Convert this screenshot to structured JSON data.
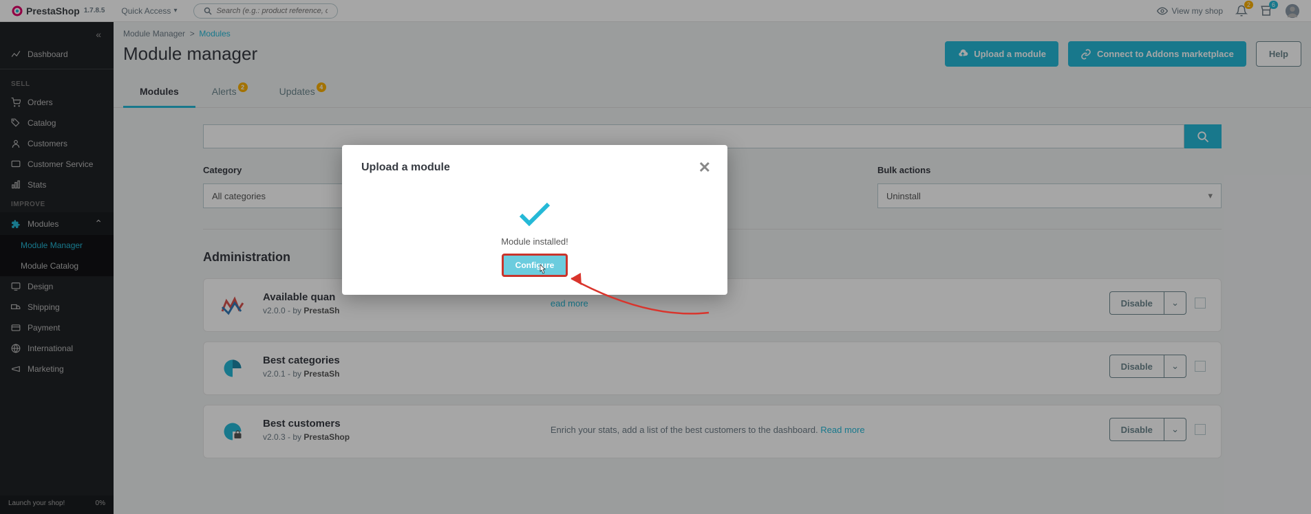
{
  "app": {
    "name": "PrestaShop",
    "version": "1.7.8.5"
  },
  "header": {
    "quick_access": "Quick Access",
    "search_placeholder": "Search (e.g.: product reference, custom",
    "view_shop": "View my shop",
    "notif_bell_count": "2",
    "notif_cart_count": "6"
  },
  "sidebar": {
    "dashboard": "Dashboard",
    "sections": {
      "sell": {
        "title": "SELL",
        "items": [
          "Orders",
          "Catalog",
          "Customers",
          "Customer Service",
          "Stats"
        ]
      },
      "improve": {
        "title": "IMPROVE",
        "items": [
          "Modules",
          "Design",
          "Shipping",
          "Payment",
          "International",
          "Marketing"
        ],
        "sub": [
          "Module Manager",
          "Module Catalog"
        ]
      }
    },
    "footer_left": "Launch your shop!",
    "footer_right": "0%"
  },
  "breadcrumb": {
    "parent": "Module Manager",
    "current": "Modules"
  },
  "page": {
    "title": "Module manager",
    "upload_btn": "Upload a module",
    "connect_btn": "Connect to Addons marketplace",
    "help_btn": "Help"
  },
  "tabs": {
    "modules": "Modules",
    "alerts": "Alerts",
    "alerts_count": "2",
    "updates": "Updates",
    "updates_count": "4"
  },
  "filters": {
    "category_label": "Category",
    "category_value": "All categories",
    "bulk_label": "Bulk actions",
    "bulk_value": "Uninstall"
  },
  "section_title": "Administration",
  "modules_list": [
    {
      "name": "Available quan",
      "version": "v2.0.0",
      "by": "by",
      "author": "PrestaSh",
      "desc": "",
      "read_more": "ead more",
      "disable": "Disable"
    },
    {
      "name": "Best categories",
      "version": "v2.0.1",
      "by": "by",
      "author": "PrestaSh",
      "desc": "",
      "read_more": "",
      "disable": "Disable"
    },
    {
      "name": "Best customers",
      "version": "v2.0.3",
      "by": "by",
      "author": "PrestaShop",
      "desc": "Enrich your stats, add a list of the best customers to the dashboard.",
      "read_more": "Read more",
      "disable": "Disable"
    }
  ],
  "modal": {
    "title": "Upload a module",
    "installed_msg": "Module installed!",
    "configure_btn": "Configure"
  }
}
